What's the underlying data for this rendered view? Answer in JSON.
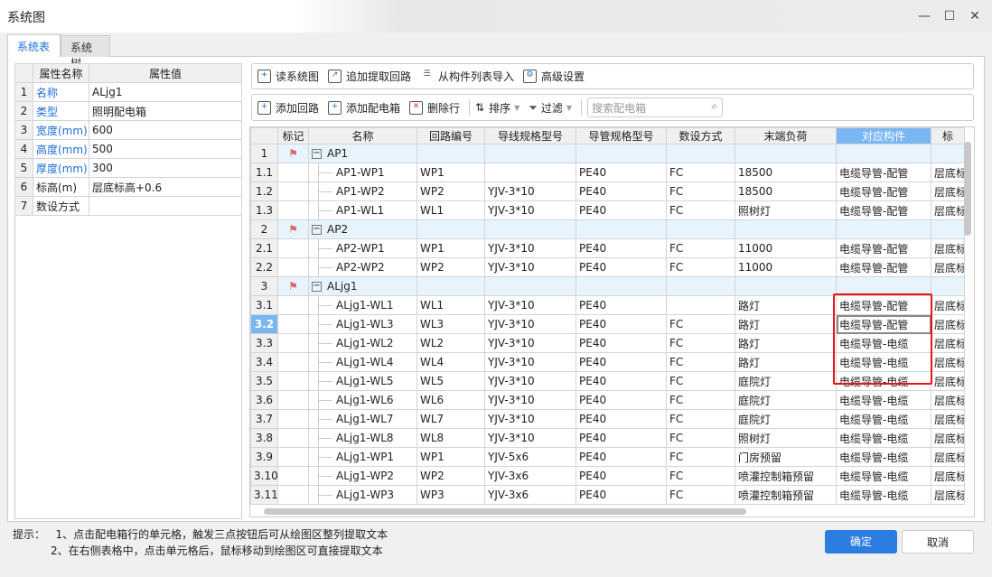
{
  "window": {
    "title": "系统图",
    "minimize": "—",
    "maximize": "☐",
    "close": "✕"
  },
  "tabs": [
    {
      "label": "系统表",
      "active": true
    },
    {
      "label": "系统树",
      "active": false
    }
  ],
  "properties": {
    "headers": [
      "属性名称",
      "属性值"
    ],
    "rows": [
      {
        "n": "1",
        "name": "名称",
        "value": "ALjg1"
      },
      {
        "n": "2",
        "name": "类型",
        "value": "照明配电箱"
      },
      {
        "n": "3",
        "name": "宽度(mm)",
        "value": "600"
      },
      {
        "n": "4",
        "name": "高度(mm)",
        "value": "500"
      },
      {
        "n": "5",
        "name": "厚度(mm)",
        "value": "300"
      },
      {
        "n": "6",
        "name": "标高(m)",
        "value": "层底标高+0.6"
      },
      {
        "n": "7",
        "name": "数设方式",
        "value": ""
      }
    ]
  },
  "toolbar1": [
    "读系统图",
    "追加提取回路",
    "从构件列表导入",
    "高级设置"
  ],
  "toolbar2": {
    "add_circuit": "添加回路",
    "add_box": "添加配电箱",
    "delete_row": "删除行",
    "sort": "排序",
    "filter": "过滤",
    "search_placeholder": "搜索配电箱"
  },
  "grid": {
    "headers": [
      "",
      "标记",
      "名称",
      "回路编号",
      "导线规格型号",
      "导管规格型号",
      "数设方式",
      "末端负荷",
      "对应构件",
      "标"
    ],
    "highlight_column": "对应构件",
    "selected_row": "3.2",
    "rows": [
      {
        "n": "1",
        "group": true,
        "name": "AP1"
      },
      {
        "n": "1.1",
        "name": "AP1-WP1",
        "circuit": "WP1",
        "wire": "",
        "pipe": "PE40",
        "method": "FC",
        "load": "18500",
        "comp": "电缆导管-配管",
        "elev": "层底标"
      },
      {
        "n": "1.2",
        "name": "AP1-WP2",
        "circuit": "WP2",
        "wire": "YJV-3*10",
        "pipe": "PE40",
        "method": "FC",
        "load": "18500",
        "comp": "电缆导管-配管",
        "elev": "层底标"
      },
      {
        "n": "1.3",
        "name": "AP1-WL1",
        "circuit": "WL1",
        "wire": "YJV-3*10",
        "pipe": "PE40",
        "method": "FC",
        "load": "照树灯",
        "comp": "电缆导管-配管",
        "elev": "层底标"
      },
      {
        "n": "2",
        "group": true,
        "name": "AP2"
      },
      {
        "n": "2.1",
        "name": "AP2-WP1",
        "circuit": "WP1",
        "wire": "YJV-3*10",
        "pipe": "PE40",
        "method": "FC",
        "load": "11000",
        "comp": "电缆导管-配管",
        "elev": "层底标"
      },
      {
        "n": "2.2",
        "name": "AP2-WP2",
        "circuit": "WP2",
        "wire": "YJV-3*10",
        "pipe": "PE40",
        "method": "FC",
        "load": "11000",
        "comp": "电缆导管-配管",
        "elev": "层底标"
      },
      {
        "n": "3",
        "group": true,
        "name": "ALjg1"
      },
      {
        "n": "3.1",
        "name": "ALjg1-WL1",
        "circuit": "WL1",
        "wire": "YJV-3*10",
        "pipe": "PE40",
        "method": "",
        "load": "路灯",
        "comp": "电缆导管-配管",
        "elev": "层底标"
      },
      {
        "n": "3.2",
        "name": "ALjg1-WL3",
        "circuit": "WL3",
        "wire": "YJV-3*10",
        "pipe": "PE40",
        "method": "FC",
        "load": "路灯",
        "comp": "电缆导管-配管",
        "elev": "层底标"
      },
      {
        "n": "3.3",
        "name": "ALjg1-WL2",
        "circuit": "WL2",
        "wire": "YJV-3*10",
        "pipe": "PE40",
        "method": "FC",
        "load": "路灯",
        "comp": "电缆导管-电缆",
        "elev": "层底标"
      },
      {
        "n": "3.4",
        "name": "ALjg1-WL4",
        "circuit": "WL4",
        "wire": "YJV-3*10",
        "pipe": "PE40",
        "method": "FC",
        "load": "路灯",
        "comp": "电缆导管-电缆",
        "elev": "层底标"
      },
      {
        "n": "3.5",
        "name": "ALjg1-WL5",
        "circuit": "WL5",
        "wire": "YJV-3*10",
        "pipe": "PE40",
        "method": "FC",
        "load": "庭院灯",
        "comp": "电缆导管-电缆",
        "elev": "层底标"
      },
      {
        "n": "3.6",
        "name": "ALjg1-WL6",
        "circuit": "WL6",
        "wire": "YJV-3*10",
        "pipe": "PE40",
        "method": "FC",
        "load": "庭院灯",
        "comp": "电缆导管-电缆",
        "elev": "层底标"
      },
      {
        "n": "3.7",
        "name": "ALjg1-WL7",
        "circuit": "WL7",
        "wire": "YJV-3*10",
        "pipe": "PE40",
        "method": "FC",
        "load": "庭院灯",
        "comp": "电缆导管-电缆",
        "elev": "层底标"
      },
      {
        "n": "3.8",
        "name": "ALjg1-WL8",
        "circuit": "WL8",
        "wire": "YJV-3*10",
        "pipe": "PE40",
        "method": "FC",
        "load": "照树灯",
        "comp": "电缆导管-电缆",
        "elev": "层底标"
      },
      {
        "n": "3.9",
        "name": "ALjg1-WP1",
        "circuit": "WP1",
        "wire": "YJV-5x6",
        "pipe": "PE40",
        "method": "FC",
        "load": "门房预留",
        "comp": "电缆导管-电缆",
        "elev": "层底标"
      },
      {
        "n": "3.10",
        "name": "ALjg1-WP2",
        "circuit": "WP2",
        "wire": "YJV-3x6",
        "pipe": "PE40",
        "method": "FC",
        "load": "喷灌控制箱预留",
        "comp": "电缆导管-电缆",
        "elev": "层底标"
      },
      {
        "n": "3.11",
        "name": "ALjg1-WP3",
        "circuit": "WP3",
        "wire": "YJV-3x6",
        "pipe": "PE40",
        "method": "FC",
        "load": "喷灌控制箱预留",
        "comp": "电缆导管-电缆",
        "elev": "层底标"
      }
    ]
  },
  "hint": {
    "label": "提示：",
    "line1": "1、点击配电箱行的单元格，触发三点按钮后可从绘图区整列提取文本",
    "line2": "2、在右侧表格中，点击单元格后，鼠标移动到绘图区可直接提取文本"
  },
  "buttons": {
    "ok": "确定",
    "cancel": "取消"
  },
  "colors": {
    "accent": "#2b7de0",
    "highlight": "#7ab6f2",
    "annotation": "#e8141b"
  }
}
